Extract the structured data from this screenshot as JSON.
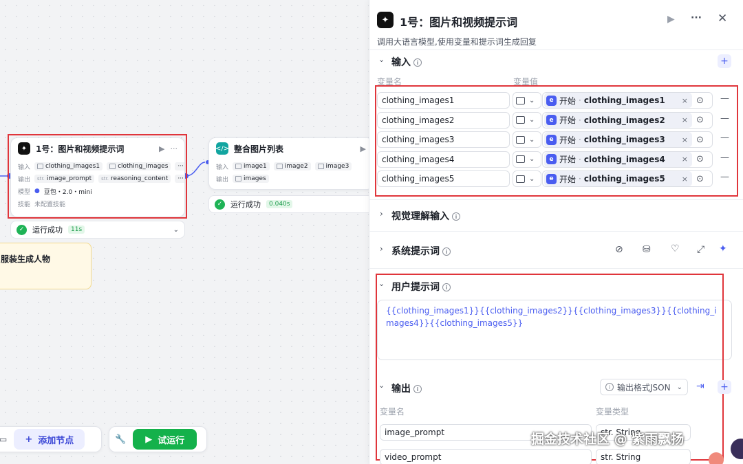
{
  "node1": {
    "title": "1号：图片和视频提示词",
    "input_label": "输入",
    "input_chip1": "clothing_images1",
    "input_chip2": "clothing_images",
    "output_label": "输出",
    "output_type": "str.",
    "output_chip1": "image_prompt",
    "output_chip2": "reasoning_content",
    "model_label": "模型",
    "model_value": "豆包・2.0・mini",
    "skill_label": "技能",
    "skill_value": "未配置技能",
    "status": "运行成功",
    "duration": "11s"
  },
  "node2": {
    "title": "整合图片列表",
    "input_label": "输入",
    "inputs": [
      "image1",
      "image2",
      "image3"
    ],
    "output_label": "输出",
    "output_chip": "images",
    "status": "运行成功",
    "duration": "0.040s"
  },
  "note_text": "服装生成人物",
  "toolbar": {
    "add_node": "添加节点",
    "test_run": "试运行"
  },
  "panel": {
    "title": "1号：图片和视频提示词",
    "subtitle": "调用大语言模型,使用变量和提示词生成回复",
    "input_section": "输入",
    "col_name": "变量名",
    "col_value": "变量值",
    "ref_prefix": "开始",
    "inputs": [
      {
        "name": "clothing_images1",
        "ref": "clothing_images1"
      },
      {
        "name": "clothing_images2",
        "ref": "clothing_images2"
      },
      {
        "name": "clothing_images3",
        "ref": "clothing_images3"
      },
      {
        "name": "clothing_images4",
        "ref": "clothing_images4"
      },
      {
        "name": "clothing_images5",
        "ref": "clothing_images5"
      }
    ],
    "vision_section": "视觉理解输入",
    "system_section": "系统提示词",
    "user_section": "用户提示词",
    "user_prompt": "{{clothing_images1}}{{clothing_images2}}{{clothing_images3}}{{clothing_images4}}{{clothing_images5}}",
    "output_section": "输出",
    "output_format": "输出格式JSON",
    "out_col_name": "变量名",
    "out_col_type": "变量类型",
    "outputs": [
      {
        "name": "image_prompt",
        "type": "str. String"
      },
      {
        "name": "video_prompt",
        "type": "str. String"
      }
    ]
  },
  "watermark": "掘金技术社区 @ 紫雨飘扬",
  "colors": {
    "accent": "#4a5df0",
    "success": "#1fb356",
    "highlight": "#e0353b"
  }
}
